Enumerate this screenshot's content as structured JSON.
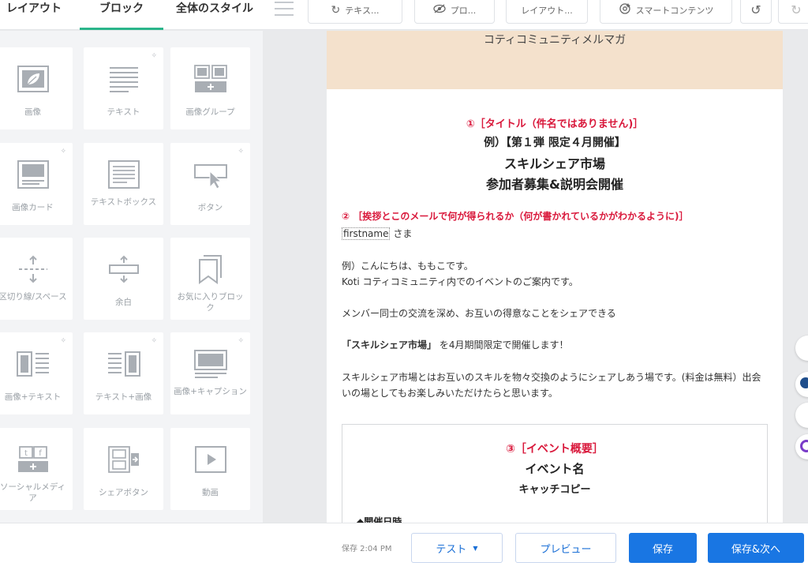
{
  "topbar": {
    "tabs": [
      {
        "label": "レイアウト"
      },
      {
        "label": "ブロック"
      },
      {
        "label": "全体のスタイル"
      }
    ],
    "buttons": [
      {
        "label": "テキス...",
        "icon": "refresh-icon"
      },
      {
        "label": "プロ...",
        "icon": "eye-slash-icon"
      },
      {
        "label": "レイアウト...",
        "icon": ""
      },
      {
        "label": "スマートコンテンツ",
        "icon": "smart-content-icon"
      }
    ],
    "undo_icon": "undo-icon",
    "redo_icon": "redo-icon"
  },
  "blocks": [
    {
      "label": "画像",
      "icon": "image-icon",
      "ai": false
    },
    {
      "label": "テキスト",
      "icon": "text-icon",
      "ai": true
    },
    {
      "label": "画像グループ",
      "icon": "image-group-icon",
      "ai": false
    },
    {
      "label": "画像カード",
      "icon": "image-card-icon",
      "ai": true
    },
    {
      "label": "テキストボックス",
      "icon": "text-box-icon",
      "ai": false
    },
    {
      "label": "ボタン",
      "icon": "button-icon",
      "ai": true
    },
    {
      "label": "区切り線/スペース",
      "icon": "divider-icon",
      "ai": false
    },
    {
      "label": "余白",
      "icon": "spacer-icon",
      "ai": false
    },
    {
      "label": "お気に入りブロック",
      "icon": "bookmark-icon",
      "ai": false
    },
    {
      "label": "画像+テキスト",
      "icon": "image-text-icon",
      "ai": true
    },
    {
      "label": "テキスト+画像",
      "icon": "text-image-icon",
      "ai": true
    },
    {
      "label": "画像+キャプション",
      "icon": "image-caption-icon",
      "ai": true
    },
    {
      "label": "ソーシャルメディア",
      "icon": "social-media-icon",
      "ai": false
    },
    {
      "label": "シェアボタン",
      "icon": "share-button-icon",
      "ai": false
    },
    {
      "label": "動画",
      "icon": "video-icon",
      "ai": false
    }
  ],
  "email": {
    "header_title": "コティコミュニティメルマガ",
    "section1_label": "①［タイトル（件名ではありません)］",
    "title_line1": "例）【第１弾 限定４月開催】",
    "title_line2": "スキルシェア市場",
    "title_line3": "参加者募集&説明会開催",
    "section2_label": "② ［挨拶とこのメールで何が得られるか（何が書かれているかがわかるように)］",
    "token": "firstname",
    "salutation": "さま",
    "greeting1": "例）こんにちは、ももこです。",
    "greeting2": "Koti コティコミュニティ内でのイベントのご案内です。",
    "body1": "メンバー同士の交流を深め、お互いの得意なことをシェアできる",
    "body2_bold": "「スキルシェア市場」",
    "body2_rest": " を4月期間限定で開催します！",
    "body3": "スキルシェア市場とはお互いのスキルを物々交換のようにシェアしあう場です。(料金は無料）出会いの場としてもお楽しみいただけたらと思います。",
    "section3_label": "③［イベント概要］",
    "event_name": "イベント名",
    "catch_copy": "キャッチコピー",
    "datetime_label": "◆開催日時"
  },
  "footer": {
    "saved_text": "保存 2:04 PM",
    "test_label": "テスト",
    "preview_label": "プレビュー",
    "save_label": "保存",
    "save_next_label": "保存&次へ"
  }
}
